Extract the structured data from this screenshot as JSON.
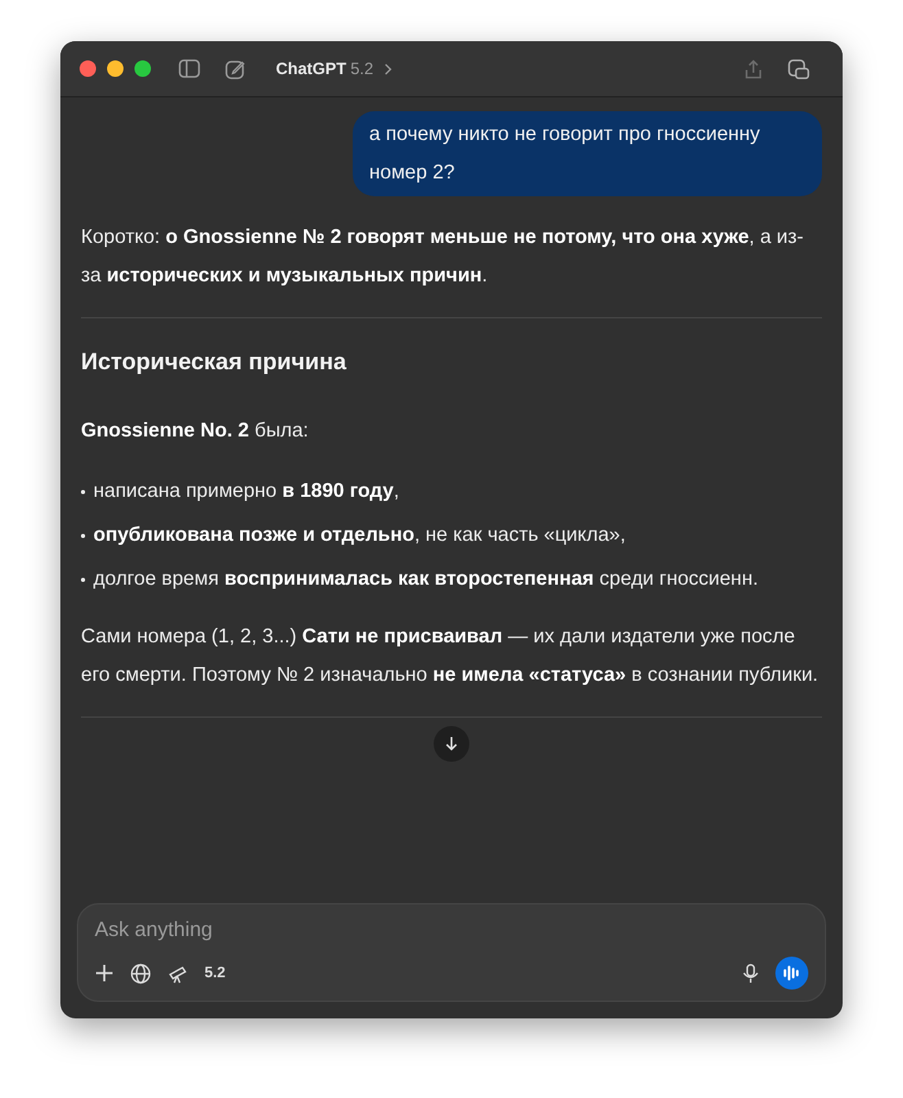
{
  "window": {
    "title": "ChatGPT",
    "model": "5.2"
  },
  "user_message": "а почему никто не говорит про гноссиенну номер 2?",
  "answer": [
    {
      "kind": "paragraph",
      "text": "Коротко: **о Gnossienne № 2 говорят меньше не потому, что она хуже**, а из-за **исторических и музыкальных причин**."
    },
    {
      "kind": "divider"
    },
    {
      "kind": "heading",
      "text": "Историческая причина"
    },
    {
      "kind": "paragraph",
      "text": "**Gnossienne No. 2** была:"
    },
    {
      "kind": "bullet",
      "text": "написана примерно **в 1890 году**,"
    },
    {
      "kind": "bullet",
      "text": "**опубликована позже и отдельно**, не как часть «цикла»,"
    },
    {
      "kind": "bullet",
      "text": "долгое время **воспринималась как второстепенная** среди гноссиенн."
    },
    {
      "kind": "paragraph",
      "text": "Сами номера (1, 2, 3...) **Сати не присваивал** — их дали издатели уже после его смерти. Поэтому № 2 изначально **не имела «статуса»** в сознании публики."
    },
    {
      "kind": "divider"
    }
  ],
  "composer": {
    "placeholder": "Ask anything",
    "model": "5.2"
  }
}
